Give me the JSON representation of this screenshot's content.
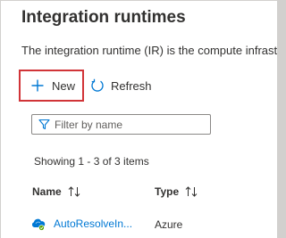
{
  "title": "Integration runtimes",
  "description": "The integration runtime (IR) is the compute infrast",
  "commands": {
    "new_label": "New",
    "refresh_label": "Refresh"
  },
  "filter": {
    "placeholder": "Filter by name",
    "value": ""
  },
  "status_text": "Showing 1 - 3 of 3 items",
  "table": {
    "columns": [
      "Name",
      "Type"
    ],
    "rows": [
      {
        "name": "AutoResolveIn...",
        "type": "Azure"
      }
    ]
  },
  "colors": {
    "highlight_border": "#d13438",
    "link": "#0078d4",
    "accent_icon": "#0078d4"
  },
  "icons": {
    "new": "plus-icon",
    "refresh": "refresh-icon",
    "filter": "funnel-icon",
    "sort": "sort-arrows-icon",
    "runtime": "cloud-runtime-icon"
  }
}
